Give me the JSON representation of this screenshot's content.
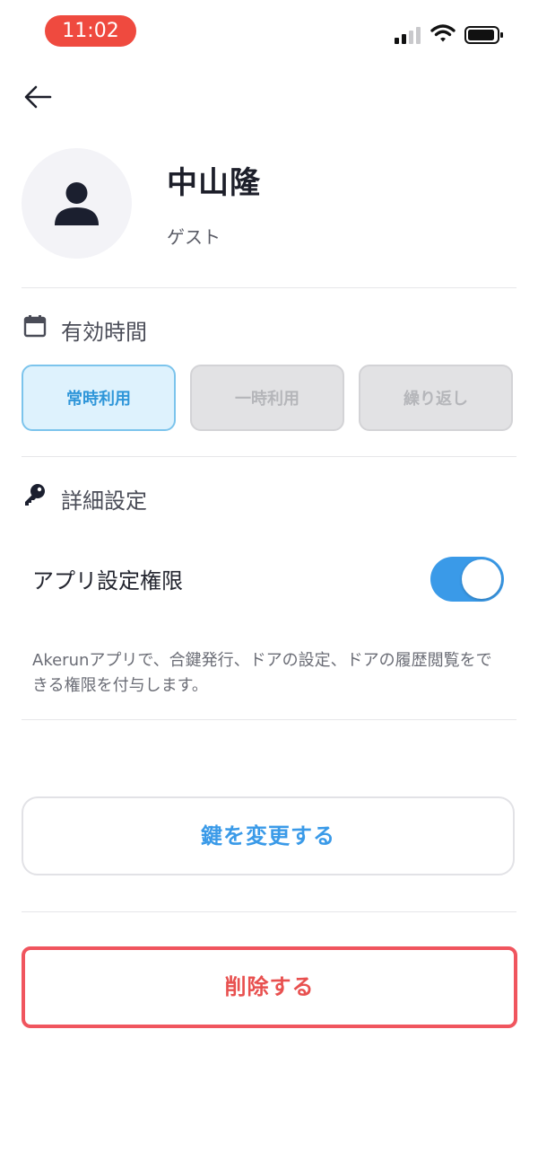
{
  "status_bar": {
    "time": "11:02",
    "icons": [
      "signal-icon",
      "wifi-icon",
      "battery-icon"
    ]
  },
  "nav": {
    "back_icon": "arrow-left-icon"
  },
  "user": {
    "name": "中山隆",
    "role": "ゲスト",
    "avatar_icon": "person-icon"
  },
  "validity": {
    "title": "有効時間",
    "icon": "calendar-icon",
    "options": [
      {
        "label": "常時利用",
        "selected": true
      },
      {
        "label": "一時利用",
        "selected": false
      },
      {
        "label": "繰り返し",
        "selected": false
      }
    ]
  },
  "details": {
    "title": "詳細設定",
    "icon": "key-icon",
    "app_permission_label": "アプリ設定権限",
    "app_permission_enabled": true,
    "description": "Akerunアプリで、合鍵発行、ドアの設定、ドアの履歴閲覧をできる権限を付与します。"
  },
  "actions": {
    "change_key": "鍵を変更する",
    "delete": "削除する"
  },
  "colors": {
    "accent": "#3a9ae8",
    "danger": "#e8504f",
    "time_pill": "#ef4a3f"
  }
}
